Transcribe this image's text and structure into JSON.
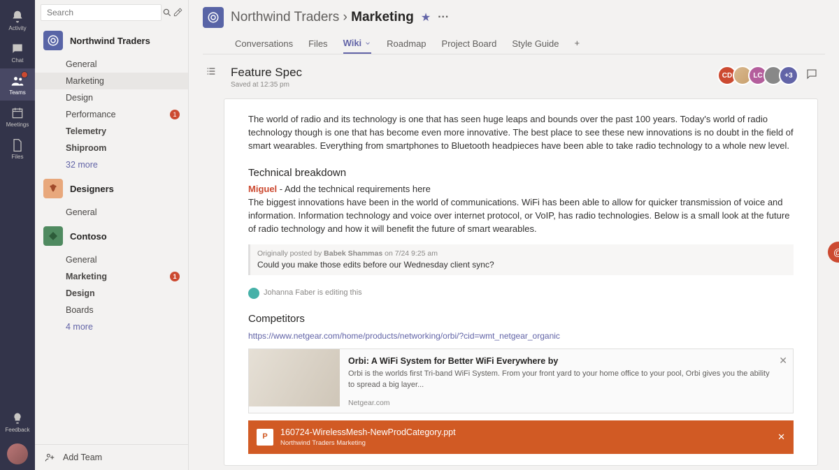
{
  "rail": {
    "activity": "Activity",
    "chat": "Chat",
    "teams": "Teams",
    "meetings": "Meetings",
    "files": "Files",
    "feedback": "Feedback"
  },
  "sidebar": {
    "search_placeholder": "Search",
    "teams": {
      "northwind": {
        "name": "Northwind Traders",
        "channels": [
          "General",
          "Marketing",
          "Design",
          "Performance",
          "Telemetry",
          "Shiproom"
        ],
        "perf_badge": "1",
        "more": "32 more"
      },
      "designers": {
        "name": "Designers",
        "channels": [
          "General"
        ]
      },
      "contoso": {
        "name": "Contoso",
        "channels": [
          "General",
          "Marketing",
          "Design",
          "Boards"
        ],
        "mkt_badge": "1",
        "more": "4 more"
      }
    },
    "add_team": "Add Team"
  },
  "header": {
    "team": "Northwind Traders",
    "sep": "›",
    "channel": "Marketing",
    "tabs": [
      "Conversations",
      "Files",
      "Wiki",
      "Roadmap",
      "Project Board",
      "Style Guide"
    ]
  },
  "page": {
    "title": "Feature Spec",
    "saved": "Saved at 12:35 pm",
    "members": {
      "m1": "CD",
      "m3": "LC",
      "more": "+3"
    }
  },
  "doc": {
    "intro": "The world of radio and its technology is one that has seen huge leaps and bounds over the past 100 years. Today's world of radio technology though is one that has become even more innovative. The best place to see these new innovations is no doubt in the field of smart wearables. Everything from smartphones to Bluetooth headpieces have been able to take radio technology to a whole new level.",
    "h_tech": "Technical breakdown",
    "mention": "Miguel",
    "mention_after": " - Add the technical requirements here",
    "tech_body": "The biggest innovations have been in the world of communications. WiFi has been able to allow for quicker transmission of voice and information. Information technology and voice over internet protocol, or VoIP, has radio technologies. Below is a small look at the future of radio technology and how it will benefit the future of smart wearables.",
    "quote_meta_pre": "Originally posted by ",
    "quote_author": "Babek Shammas",
    "quote_meta_post": " on 7/24 9:25 am",
    "quote_text": "Could you make those edits before our Wednesday client sync?",
    "editing": "Johanna Faber is editing this",
    "h_comp": "Competitors",
    "link": "https://www.netgear.com/home/products/networking/orbi/?cid=wmt_netgear_organic",
    "card": {
      "title": "Orbi: A WiFi System for Better WiFi Everywhere by",
      "desc": "Orbi is the worlds first Tri-band WiFi System. From your front yard to your home office to your pool, Orbi gives you the ability to spread a big layer...",
      "source": "Netgear.com"
    },
    "attach": {
      "name": "160724-WirelessMesh-NewProdCategory.ppt",
      "sub": "Northwind Traders    Marketing"
    }
  }
}
